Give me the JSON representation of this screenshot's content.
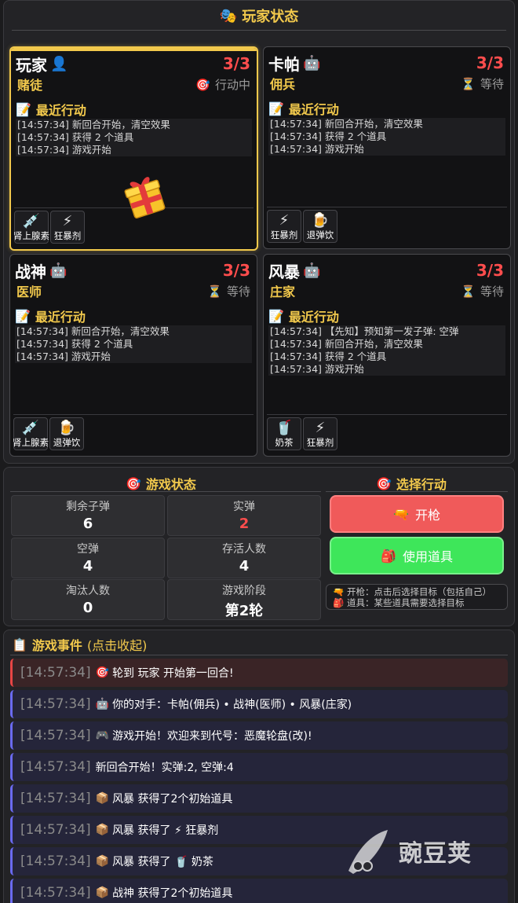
{
  "header": {
    "icon": "theater-masks-icon",
    "icon_glyph": "🎭",
    "title": "玩家状态"
  },
  "players": [
    {
      "name": "玩家",
      "avatar_glyph": "👤",
      "hp": "3/3",
      "role": "赌徒",
      "status_glyph": "🎯",
      "status": "行动中",
      "recent_title": "最近行动",
      "log": [
        "[14:57:34] 新回合开始，清空效果",
        "[14:57:34] 获得 2 个道具",
        "[14:57:34] 游戏开始"
      ],
      "items": [
        {
          "glyph": "💉",
          "label": "肾上腺素"
        },
        {
          "glyph": "⚡",
          "label": "狂暴剂"
        }
      ]
    },
    {
      "name": "卡帕",
      "avatar_glyph": "🤖",
      "hp": "3/3",
      "role": "佣兵",
      "status_glyph": "⏳",
      "status": "等待",
      "recent_title": "最近行动",
      "log": [
        "[14:57:34] 新回合开始，清空效果",
        "[14:57:34] 获得 2 个道具",
        "[14:57:34] 游戏开始"
      ],
      "items": [
        {
          "glyph": "⚡",
          "label": "狂暴剂"
        },
        {
          "glyph": "🍺",
          "label": "退弹饮"
        }
      ]
    },
    {
      "name": "战神",
      "avatar_glyph": "🤖",
      "hp": "3/3",
      "role": "医师",
      "status_glyph": "⏳",
      "status": "等待",
      "recent_title": "最近行动",
      "log": [
        "[14:57:34] 新回合开始，清空效果",
        "[14:57:34] 获得 2 个道具",
        "[14:57:34] 游戏开始"
      ],
      "items": [
        {
          "glyph": "💉",
          "label": "肾上腺素"
        },
        {
          "glyph": "🍺",
          "label": "退弹饮"
        }
      ]
    },
    {
      "name": "风暴",
      "avatar_glyph": "🤖",
      "hp": "3/3",
      "role": "庄家",
      "status_glyph": "⏳",
      "status": "等待",
      "recent_title": "最近行动",
      "log": [
        "[14:57:34] 【先知】预知第一发子弹: 空弹",
        "[14:57:34] 新回合开始，清空效果",
        "[14:57:34] 获得 2 个道具",
        "[14:57:34] 游戏开始"
      ],
      "items": [
        {
          "glyph": "🥤",
          "label": "奶茶"
        },
        {
          "glyph": "⚡",
          "label": "狂暴剂"
        }
      ]
    }
  ],
  "game_status": {
    "title": "游戏状态",
    "icon_glyph": "🎯",
    "stats": [
      {
        "label": "剩余子弹",
        "value": "6"
      },
      {
        "label": "实弹",
        "value": "2"
      },
      {
        "label": "空弹",
        "value": "4"
      },
      {
        "label": "存活人数",
        "value": "4"
      },
      {
        "label": "淘汰人数",
        "value": "0"
      },
      {
        "label": "游戏阶段",
        "value": "第2轮"
      }
    ]
  },
  "actions": {
    "title": "选择行动",
    "icon_glyph": "🎯",
    "shoot_glyph": "🔫",
    "shoot_label": "开枪",
    "item_glyph": "🎒",
    "item_label": "使用道具",
    "hint_shoot": "开枪：点击后选择目标（包括自己）",
    "hint_item": "道具：某些道具需要选择目标"
  },
  "events": {
    "title": "游戏事件",
    "subtitle": "(点击收起)",
    "icon_glyph": "📋",
    "list": [
      {
        "time": "[14:57:34]",
        "glyph": "🎯",
        "text": "轮到 玩家 开始第一回合!"
      },
      {
        "time": "[14:57:34]",
        "glyph": "🤖",
        "text": "你的对手：卡帕(佣兵) • 战神(医师) • 风暴(庄家)"
      },
      {
        "time": "[14:57:34]",
        "glyph": "🎮",
        "text": "游戏开始！欢迎来到代号：恶魔轮盘(改)!"
      },
      {
        "time": "[14:57:34]",
        "glyph": "",
        "text": "新回合开始！实弹:2, 空弹:4"
      },
      {
        "time": "[14:57:34]",
        "glyph": "📦",
        "text": "风暴 获得了2个初始道具"
      },
      {
        "time": "[14:57:34]",
        "glyph": "📦",
        "text": "风暴 获得了 ⚡ 狂暴剂"
      },
      {
        "time": "[14:57:34]",
        "glyph": "📦",
        "text": "风暴 获得了 🥤 奶茶"
      },
      {
        "time": "[14:57:34]",
        "glyph": "📦",
        "text": "战神 获得了2个初始道具"
      }
    ]
  },
  "watermark": {
    "text": "豌豆荚"
  },
  "colors": {
    "accent": "#f2c94c",
    "hp": "#ff4d4d",
    "shoot_button": "#f05a5a",
    "item_button": "#3ee65a"
  }
}
